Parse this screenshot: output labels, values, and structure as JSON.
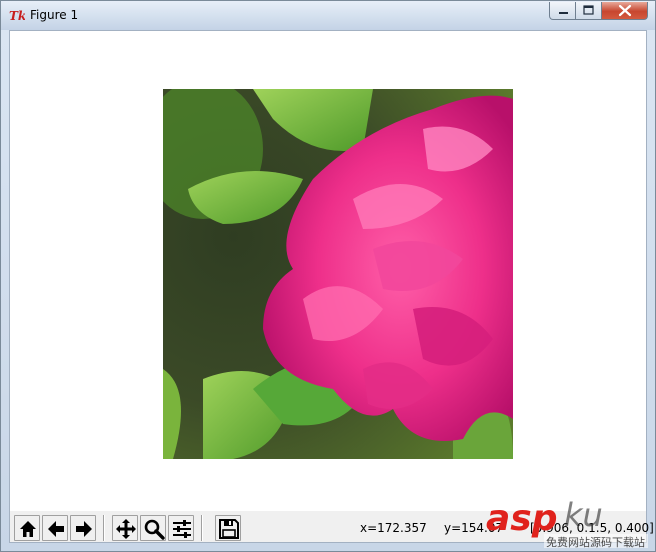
{
  "window": {
    "title": "Figure 1",
    "app_icon": "tk-icon",
    "controls": [
      "minimize-icon",
      "maximize-icon",
      "close-icon"
    ]
  },
  "figure": {
    "image_description_icon": "peony-photo"
  },
  "toolbar": {
    "buttons": [
      {
        "name": "home-button",
        "icon": "home-icon"
      },
      {
        "name": "back-button",
        "icon": "left-arrow-icon"
      },
      {
        "name": "forward-button",
        "icon": "right-arrow-icon"
      },
      {
        "name": "pan-button",
        "icon": "move-arrows-icon"
      },
      {
        "name": "zoom-button",
        "icon": "magnifier-icon"
      },
      {
        "name": "configure-subplots-button",
        "icon": "sliders-icon"
      },
      {
        "name": "save-button",
        "icon": "floppy-disk-icon"
      }
    ],
    "x_readout": "x=172.357",
    "y_readout": "y=154.07",
    "pixel_readout": "[0.906, 0.1.5, 0.400]"
  },
  "watermark": {
    "brand_text": "aspku",
    "tagline": "免费网站源码下载站",
    "colors": {
      "asp": "#e0221c",
      "ku": "#2b2b2b"
    }
  },
  "colors": {
    "titlebar": "#d5e1ef",
    "close_button": "#c7462f",
    "toolbar_bg": "#f0f0f0"
  }
}
